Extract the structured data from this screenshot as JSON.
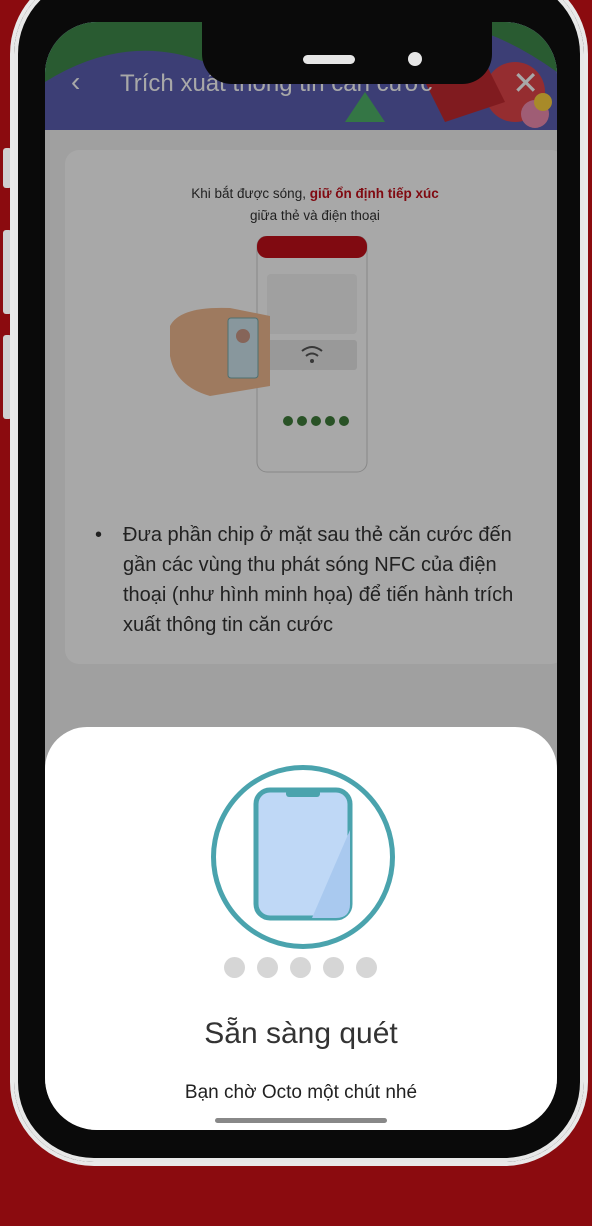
{
  "header": {
    "back_icon": "chevron-left-icon",
    "title": "Trích xuất thông tin căn cước",
    "close_icon": "close-icon"
  },
  "card": {
    "top_line1_prefix": "Khi bắt được sóng, ",
    "top_line1_emph": "giữ ổn định tiếp xúc",
    "top_line2": "giữa thẻ và điện thoại",
    "bullet": "Đưa phần chip ở mặt sau thẻ căn cước đến gần các vùng thu phát sóng NFC của điện thoại (như hình minh họa) để tiến hành trích xuất thông tin căn cước"
  },
  "sheet": {
    "title": "Sẵn sàng quét",
    "subtitle": "Bạn chờ Octo một chút nhé"
  },
  "colors": {
    "background": "#8b0b0f",
    "accent": "#c3101b",
    "scan_ring": "#4aa3ad"
  }
}
